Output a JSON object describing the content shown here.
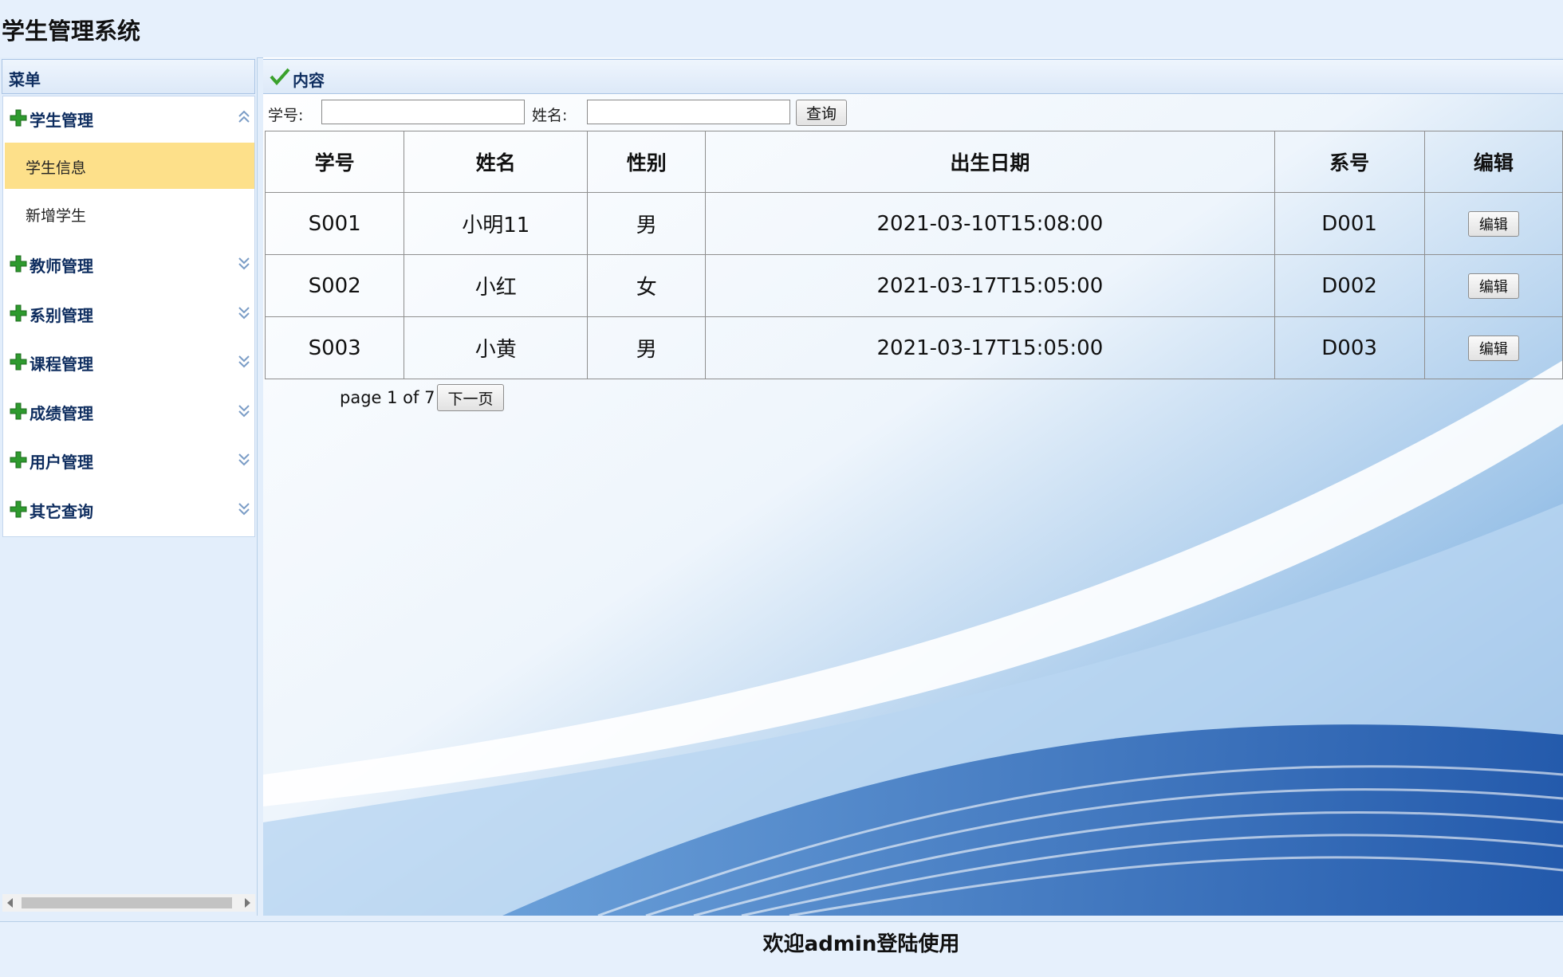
{
  "app": {
    "title": "学生管理系统"
  },
  "sidebar": {
    "header": "菜单",
    "groups": [
      {
        "label": "学生管理",
        "expanded": true,
        "items": [
          "学生信息",
          "新增学生"
        ],
        "active_item": "学生信息"
      },
      {
        "label": "教师管理",
        "expanded": false
      },
      {
        "label": "系别管理",
        "expanded": false
      },
      {
        "label": "课程管理",
        "expanded": false
      },
      {
        "label": "成绩管理",
        "expanded": false
      },
      {
        "label": "用户管理",
        "expanded": false
      },
      {
        "label": "其它查询",
        "expanded": false
      }
    ]
  },
  "content": {
    "header": "内容",
    "search": {
      "id_label": "学号:",
      "id_value": "",
      "name_label": "姓名:",
      "name_value": "",
      "query_button": "查询"
    },
    "table": {
      "columns": [
        "学号",
        "姓名",
        "性别",
        "出生日期",
        "系号",
        "编辑"
      ],
      "rows": [
        [
          "S001",
          "小明11",
          "男",
          "2021-03-10T15:08:00",
          "D001",
          "编辑"
        ],
        [
          "S002",
          "小红",
          "女",
          "2021-03-17T15:05:00",
          "D002",
          "编辑"
        ],
        [
          "S003",
          "小黄",
          "男",
          "2021-03-17T15:05:00",
          "D003",
          "编辑"
        ]
      ]
    },
    "pager": {
      "text": "page 1 of 7",
      "next_button": "下一页"
    }
  },
  "footer": {
    "welcome": "欢迎admin登陆使用"
  },
  "colors": {
    "accent": "#0e2d5f",
    "active_item": "#fde08a",
    "plus_green": "#2e9a2e",
    "background": "#e3eefb"
  },
  "icons": {
    "group": "plus-icon",
    "collapsed": "double-chevron-down-icon",
    "expanded": "double-chevron-up-icon",
    "content": "checkmark-icon"
  }
}
